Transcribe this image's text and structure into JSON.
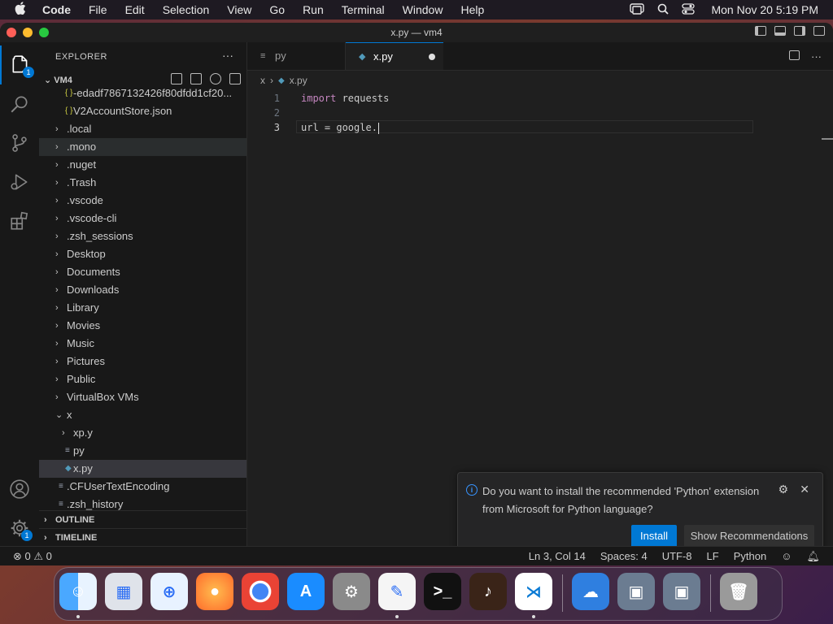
{
  "menubar": {
    "apple": "",
    "items": [
      "Code",
      "File",
      "Edit",
      "Selection",
      "View",
      "Go",
      "Run",
      "Terminal",
      "Window",
      "Help"
    ],
    "clock": "Mon Nov 20  5:19 PM"
  },
  "window": {
    "title": "x.py — vm4"
  },
  "activity": {
    "explorer_badge": "1",
    "manage_badge": "1"
  },
  "sidebar": {
    "header": "EXPLORER",
    "more": "···",
    "root": "VM4",
    "tree": [
      {
        "label": "-edadf7867132426f80dfdd1cf20...",
        "depth": 1,
        "kind": "json"
      },
      {
        "label": "V2AccountStore.json",
        "depth": 1,
        "kind": "json"
      },
      {
        "label": ".local",
        "depth": 0,
        "kind": "folder"
      },
      {
        "label": ".mono",
        "depth": 0,
        "kind": "folder",
        "state": "hover"
      },
      {
        "label": ".nuget",
        "depth": 0,
        "kind": "folder"
      },
      {
        "label": ".Trash",
        "depth": 0,
        "kind": "folder"
      },
      {
        "label": ".vscode",
        "depth": 0,
        "kind": "folder"
      },
      {
        "label": ".vscode-cli",
        "depth": 0,
        "kind": "folder"
      },
      {
        "label": ".zsh_sessions",
        "depth": 0,
        "kind": "folder"
      },
      {
        "label": "Desktop",
        "depth": 0,
        "kind": "folder"
      },
      {
        "label": "Documents",
        "depth": 0,
        "kind": "folder"
      },
      {
        "label": "Downloads",
        "depth": 0,
        "kind": "folder"
      },
      {
        "label": "Library",
        "depth": 0,
        "kind": "folder"
      },
      {
        "label": "Movies",
        "depth": 0,
        "kind": "folder"
      },
      {
        "label": "Music",
        "depth": 0,
        "kind": "folder"
      },
      {
        "label": "Pictures",
        "depth": 0,
        "kind": "folder"
      },
      {
        "label": "Public",
        "depth": 0,
        "kind": "folder"
      },
      {
        "label": "VirtualBox VMs",
        "depth": 0,
        "kind": "folder"
      },
      {
        "label": "x",
        "depth": 0,
        "kind": "folder-open"
      },
      {
        "label": "xp.y",
        "depth": 1,
        "kind": "folder"
      },
      {
        "label": "py",
        "depth": 1,
        "kind": "text"
      },
      {
        "label": "x.py",
        "depth": 1,
        "kind": "python",
        "state": "selected"
      },
      {
        "label": ".CFUserTextEncoding",
        "depth": 0,
        "kind": "text"
      },
      {
        "label": ".zsh_history",
        "depth": 0,
        "kind": "text"
      }
    ],
    "outline": "OUTLINE",
    "timeline": "TIMELINE"
  },
  "tabs": [
    {
      "label": "py",
      "icon": "text-file-icon",
      "active": false
    },
    {
      "label": "x.py",
      "icon": "python-file-icon",
      "active": true,
      "dirty": true
    }
  ],
  "breadcrumb": [
    "x",
    "x.py"
  ],
  "editor": {
    "lines": [
      {
        "num": "1",
        "keyword": "import",
        "rest": " requests"
      },
      {
        "num": "2",
        "keyword": "",
        "rest": ""
      },
      {
        "num": "3",
        "keyword": "",
        "rest": "url = google."
      }
    ],
    "current_line": 3
  },
  "notification": {
    "message": "Do you want to install the recommended 'Python' extension from Microsoft for Python language?",
    "install_label": "Install",
    "recs_label": "Show Recommendations"
  },
  "status": {
    "errors": "0",
    "warnings": "0",
    "position": "Ln 3, Col 14",
    "spaces": "Spaces: 4",
    "encoding": "UTF-8",
    "eol": "LF",
    "language": "Python"
  },
  "dock": {
    "apps": [
      "finder",
      "launchpad",
      "safari",
      "firefox",
      "chrome",
      "app-store",
      "system-settings",
      "textedit",
      "terminal",
      "garageband",
      "vscode",
      "weather",
      "virtualbox",
      "virtualbox-vm",
      "trash"
    ]
  },
  "colors": {
    "accent": "#0078d4",
    "editor_bg": "#1f1f1f",
    "sidebar_bg": "#181818"
  }
}
